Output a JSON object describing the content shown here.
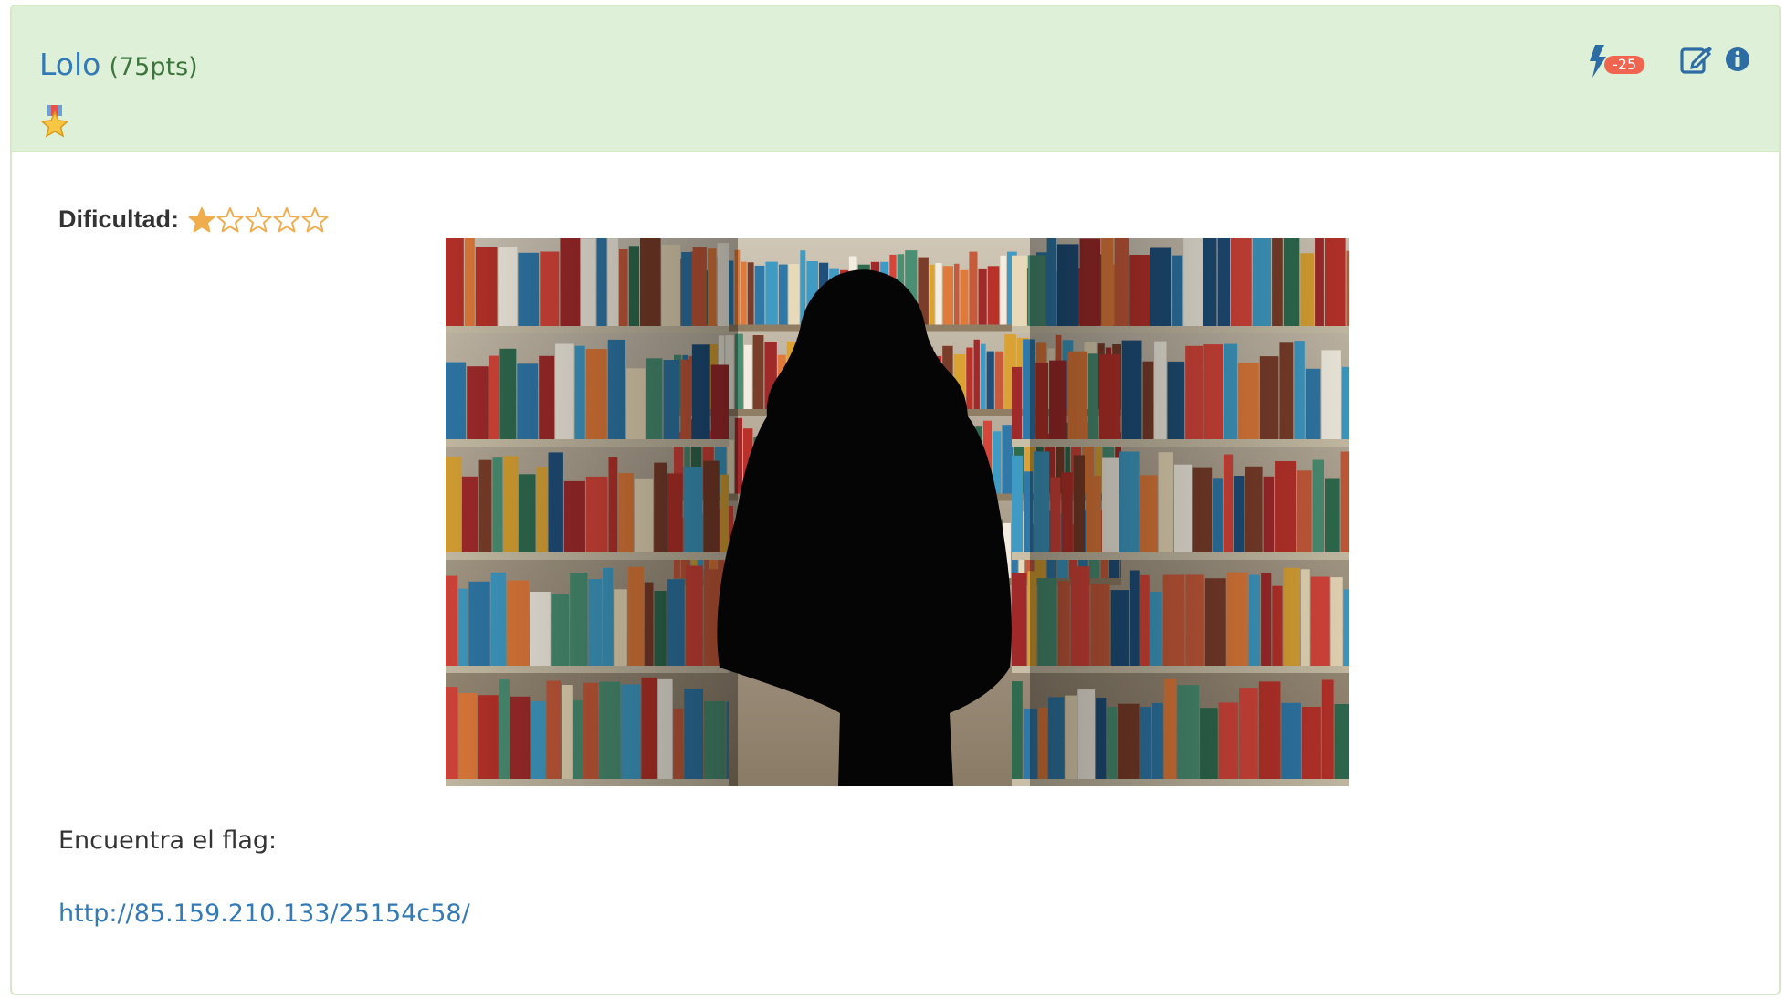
{
  "header": {
    "challenge_name": "Lolo",
    "points": "(75pts)",
    "medal_icon": "medal-star-icon",
    "hint_badge": "-25",
    "accent_color": "#337ab7",
    "heading_bg": "#dff0d8",
    "badge_color": "#f0654f"
  },
  "body": {
    "difficulty_label": "Dificultad:",
    "difficulty_rating": 1,
    "difficulty_max": 5,
    "image_alt": "Silueta en un pasillo de biblioteca",
    "description": "Encuentra el flag:",
    "link_text": "http://85.159.210.133/25154c58/"
  }
}
